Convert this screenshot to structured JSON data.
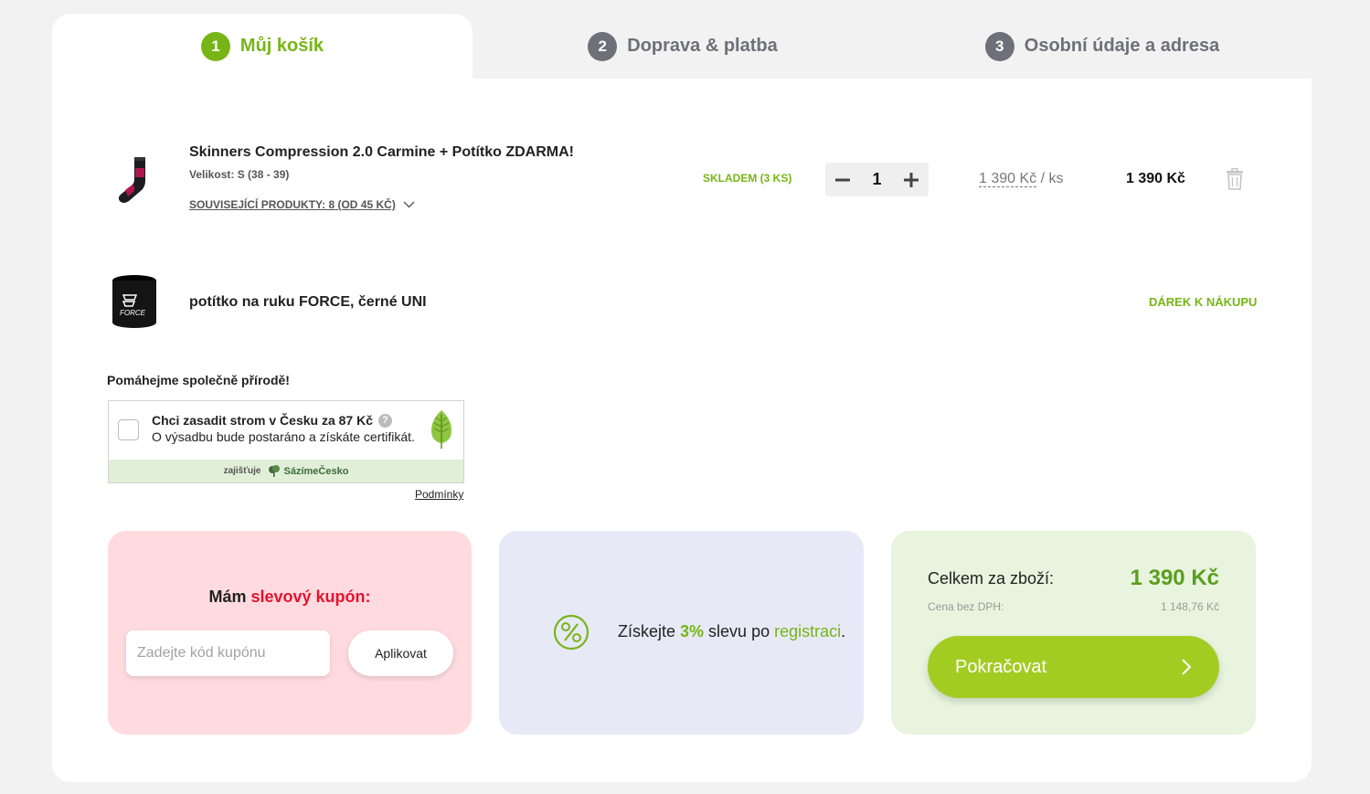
{
  "steps": [
    {
      "num": "1",
      "label": "Můj košík"
    },
    {
      "num": "2",
      "label": "Doprava & platba"
    },
    {
      "num": "3",
      "label": "Osobní údaje a adresa"
    }
  ],
  "colors": {
    "accent": "#77b516",
    "button": "#a3cc23",
    "coupon_red": "#e8112d"
  },
  "cart": {
    "items": [
      {
        "title": "Skinners Compression 2.0 Carmine + Potítko ZDARMA!",
        "variant": "Velikost: S (38 - 39)",
        "related": "SOUVISEJÍCÍ PRODUKTY: 8 (OD 45 KČ)",
        "stock": "SKLADEM (3 KS)",
        "quantity": "1",
        "unit_price": "1 390 Kč",
        "unit_suffix": " / ks",
        "total": "1 390 Kč"
      },
      {
        "title": "potítko na ruku FORCE, černé UNI",
        "gift_label": "DÁREK K NÁKUPU"
      }
    ]
  },
  "tree": {
    "heading": "Pomáhejme společně přírodě!",
    "title": "Chci zasadit strom v Česku za 87 Kč",
    "help": "?",
    "subtitle": "O výsadbu bude postaráno a získáte certifikát.",
    "provided_by": "zajišťuje",
    "provider": "SázímeČesko",
    "conditions": "Podmínky"
  },
  "coupon": {
    "heading_prefix": "Mám ",
    "heading_highlight": "slevový kupón:",
    "placeholder": "Zadejte kód kupónu",
    "apply": "Aplikovat"
  },
  "promo": {
    "prefix": "Získejte ",
    "percent": "3%",
    "middle": " slevu po ",
    "link": "registraci",
    "suffix": "."
  },
  "summary": {
    "total_label": "Celkem za zboží:",
    "total_value": "1 390 Kč",
    "vat_label": "Cena bez DPH:",
    "vat_value": "1 148,76 Kč",
    "continue": "Pokračovat"
  }
}
